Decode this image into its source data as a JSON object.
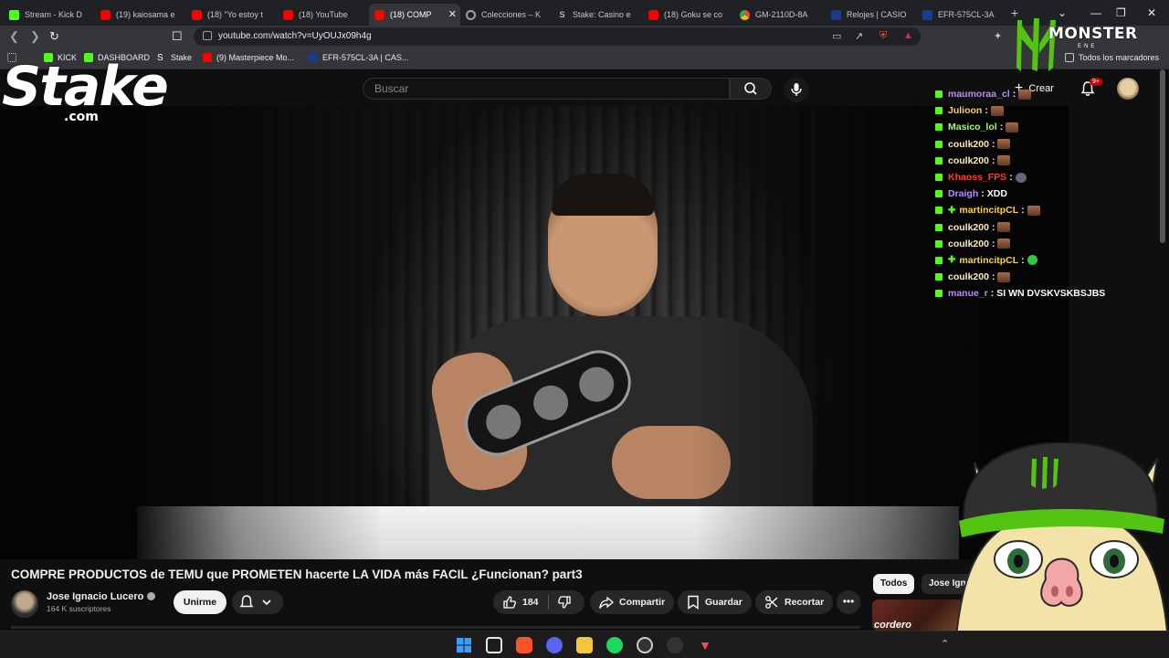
{
  "browser": {
    "tabs": [
      {
        "title": "Stream - Kick D",
        "favicon": "kick-icon",
        "active": false
      },
      {
        "title": "(19) kaiosama e",
        "favicon": "youtube-icon",
        "active": false
      },
      {
        "title": "(18) \"Yo estoy t",
        "favicon": "youtube-icon",
        "active": false
      },
      {
        "title": "(18) YouTube",
        "favicon": "youtube-icon",
        "active": false
      },
      {
        "title": "(18) COMP",
        "favicon": "youtube-icon",
        "active": true
      },
      {
        "title": "Colecciones – K",
        "favicon": "gear-icon",
        "active": false
      },
      {
        "title": "Stake: Casino e",
        "favicon": "stake-icon",
        "active": false
      },
      {
        "title": "(18) Goku se co",
        "favicon": "youtube-icon",
        "active": false
      },
      {
        "title": "GM-2110D-8A",
        "favicon": "chrome-icon",
        "active": false
      },
      {
        "title": "Relojes | CASIO",
        "favicon": "casio-icon",
        "active": false
      },
      {
        "title": "EFR-575CL-3A",
        "favicon": "casio-icon",
        "active": false
      }
    ],
    "url": "youtube.com/watch?v=UyOUJx09h4g",
    "bookmarks": [
      {
        "label": "",
        "icon": "grid-icon"
      },
      {
        "label": "KICK",
        "icon": "kick-icon"
      },
      {
        "label": "DASHBOARD",
        "icon": "kick-icon"
      },
      {
        "label": "Stake",
        "icon": "stake-icon"
      },
      {
        "label": "(9) Masterpiece Mo...",
        "icon": "youtube-icon"
      },
      {
        "label": "EFR-575CL-3A | CAS...",
        "icon": "casio-icon"
      }
    ],
    "all_bookmarks": "Todos los marcadores"
  },
  "youtube": {
    "search_placeholder": "Buscar",
    "create_label": "Crear",
    "notification_count": "9+",
    "video_title": "COMPRE PRODUCTOS de TEMU que PROMETEN hacerte LA VIDA más FACIL ¿Funcionan? part3",
    "channel_name": "Jose Ignacio Lucero",
    "subscribers": "164 K suscriptores",
    "join_label": "Unirme",
    "like_count": "184",
    "share_label": "Compartir",
    "save_label": "Guardar",
    "clip_label": "Recortar",
    "chips": [
      "Todos",
      "Jose Igna"
    ],
    "recommended_thumb_text": "cordero"
  },
  "overlay": {
    "stake_logo": "Stake",
    "stake_com": ".com",
    "monster_text": "MONSTER",
    "monster_sub": "ENE",
    "chat": [
      {
        "user": "maumoraa_cl",
        "color": "#b98cff",
        "msg": "",
        "emote": "emote",
        "badge": true,
        "plus": false
      },
      {
        "user": "Julioon",
        "color": "#ffd24a",
        "msg": "",
        "emote": "emote",
        "badge": true,
        "plus": false
      },
      {
        "user": "Masico_lol",
        "color": "#9cff5e",
        "msg": "",
        "emote": "emote",
        "badge": true,
        "plus": false
      },
      {
        "user": "coulk200",
        "color": "#ffe9b8",
        "msg": "",
        "emote": "emote",
        "badge": true,
        "plus": false
      },
      {
        "user": "coulk200",
        "color": "#ffe9b8",
        "msg": "",
        "emote": "emote",
        "badge": true,
        "plus": false
      },
      {
        "user": "Khaoss_FPS",
        "color": "#ff3b3b",
        "msg": "",
        "emote": "grey",
        "badge": true,
        "plus": false
      },
      {
        "user": "Draigh",
        "color": "#b98cff",
        "msg": "XDD",
        "emote": "",
        "badge": true,
        "plus": false
      },
      {
        "user": "martincitpCL",
        "color": "#ffd24a",
        "msg": "",
        "emote": "emote",
        "badge": true,
        "plus": true
      },
      {
        "user": "coulk200",
        "color": "#ffe9b8",
        "msg": "",
        "emote": "emote",
        "badge": true,
        "plus": false
      },
      {
        "user": "coulk200",
        "color": "#ffe9b8",
        "msg": "",
        "emote": "emote",
        "badge": true,
        "plus": false
      },
      {
        "user": "martincitpCL",
        "color": "#ffd24a",
        "msg": "",
        "emote": "green",
        "badge": true,
        "plus": true
      },
      {
        "user": "coulk200",
        "color": "#ffe9b8",
        "msg": "",
        "emote": "emote",
        "badge": true,
        "plus": false
      },
      {
        "user": "manue_r",
        "color": "#b98cff",
        "msg": "SI WN DVSKVSKBSJBS",
        "emote": "",
        "badge": true,
        "plus": false
      }
    ]
  },
  "taskbar": {
    "icons": [
      "windows-start-icon",
      "taskview-icon",
      "brave-icon",
      "discord-icon",
      "file-explorer-icon",
      "spotify-icon",
      "obs-icon",
      "app-icon",
      "valorant-icon"
    ]
  }
}
